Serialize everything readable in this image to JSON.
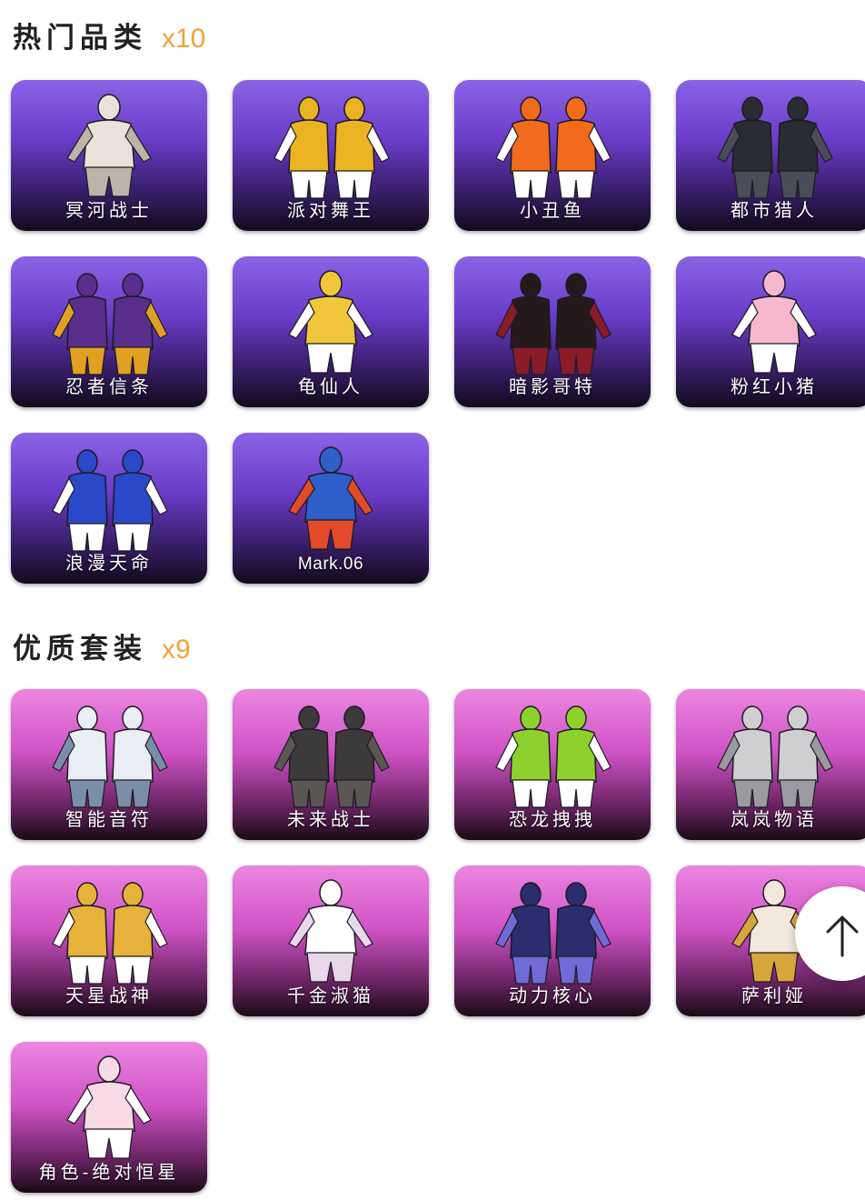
{
  "sections": [
    {
      "title": "热门品类",
      "count": "x10",
      "theme": "purple",
      "items": [
        {
          "label": "冥河战士",
          "figure": "mummy-outfit",
          "colors": [
            "#e8e2da",
            "#bdb3a8"
          ]
        },
        {
          "label": "派对舞王",
          "figure": "gold-party-outfit",
          "colors": [
            "#e9b322",
            "#ffffff"
          ]
        },
        {
          "label": "小丑鱼",
          "figure": "clownfish-outfit",
          "colors": [
            "#f26a1b",
            "#ffffff"
          ]
        },
        {
          "label": "都市猎人",
          "figure": "dark-hunter-outfit",
          "colors": [
            "#2a2c33",
            "#4a4d57"
          ]
        },
        {
          "label": "忍者信条",
          "figure": "ninja-outfit",
          "colors": [
            "#5a2e8c",
            "#e0a022"
          ]
        },
        {
          "label": "龟仙人",
          "figure": "turtle-hermit-outfit",
          "colors": [
            "#f2c63b",
            "#ffffff"
          ]
        },
        {
          "label": "暗影哥特",
          "figure": "gothic-outfit",
          "colors": [
            "#26191c",
            "#8a1c2a"
          ]
        },
        {
          "label": "粉红小猪",
          "figure": "pink-pig-outfit",
          "colors": [
            "#f7b8cf",
            "#ffffff"
          ]
        },
        {
          "label": "浪漫天命",
          "figure": "romance-outfit",
          "colors": [
            "#2b48c9",
            "#ffffff"
          ]
        },
        {
          "label": "Mark.06",
          "figure": "mech-suit-outfit",
          "colors": [
            "#2f5fc8",
            "#e24a2a"
          ]
        }
      ]
    },
    {
      "title": "优质套装",
      "count": "x9",
      "theme": "pink",
      "items": [
        {
          "label": "智能音符",
          "figure": "smart-note-outfit",
          "colors": [
            "#e8eef4",
            "#7a8ea8"
          ]
        },
        {
          "label": "未来战士",
          "figure": "future-warrior-outfit",
          "colors": [
            "#3c3a3a",
            "#5a5654"
          ]
        },
        {
          "label": "恐龙拽拽",
          "figure": "dinosaur-outfit",
          "colors": [
            "#8fd12c",
            "#ffffff"
          ]
        },
        {
          "label": "岚岚物语",
          "figure": "gray-tale-outfit",
          "colors": [
            "#cfcfd2",
            "#9a9aa0"
          ]
        },
        {
          "label": "天星战神",
          "figure": "star-god-outfit",
          "colors": [
            "#e6b23a",
            "#ffffff"
          ]
        },
        {
          "label": "千金淑猫",
          "figure": "lady-cat-outfit",
          "colors": [
            "#ffffff",
            "#e9d7ec"
          ]
        },
        {
          "label": "动力核心",
          "figure": "power-core-outfit",
          "colors": [
            "#2a2d6e",
            "#6f6ad8"
          ]
        },
        {
          "label": "萨利娅",
          "figure": "saliya-outfit",
          "colors": [
            "#f3e7dc",
            "#d8a53b"
          ]
        },
        {
          "label": "角色-绝对恒星",
          "figure": "absolute-star-outfit",
          "colors": [
            "#f8d9e6",
            "#ffffff"
          ]
        }
      ]
    }
  ],
  "scroll_top_button": {
    "icon": "arrow-up-icon"
  }
}
